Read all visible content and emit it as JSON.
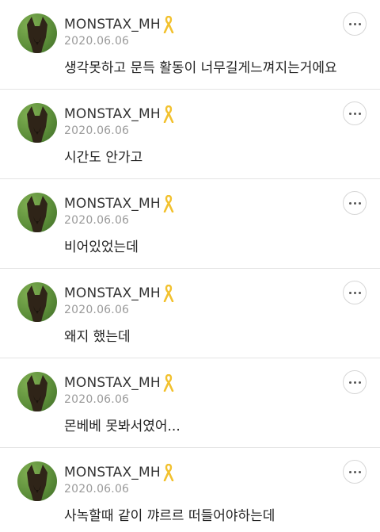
{
  "posts": [
    {
      "username": "MONSTAX_MH",
      "date": "2020.06.06",
      "text": "생각못하고 문득 활동이 너무길게느껴지는거에요"
    },
    {
      "username": "MONSTAX_MH",
      "date": "2020.06.06",
      "text": "시간도 안가고"
    },
    {
      "username": "MONSTAX_MH",
      "date": "2020.06.06",
      "text": "비어있었는데"
    },
    {
      "username": "MONSTAX_MH",
      "date": "2020.06.06",
      "text": "왜지 했는데"
    },
    {
      "username": "MONSTAX_MH",
      "date": "2020.06.06",
      "text": "몬베베 못봐서였어..."
    },
    {
      "username": "MONSTAX_MH",
      "date": "2020.06.06",
      "text": "사녹할때 같이 꺄르르 떠들어야하는데"
    }
  ],
  "icons": {
    "ribbon": "yellow-ribbon-icon",
    "more": "more-options-icon",
    "ribbon_color": "#f2c12e"
  }
}
